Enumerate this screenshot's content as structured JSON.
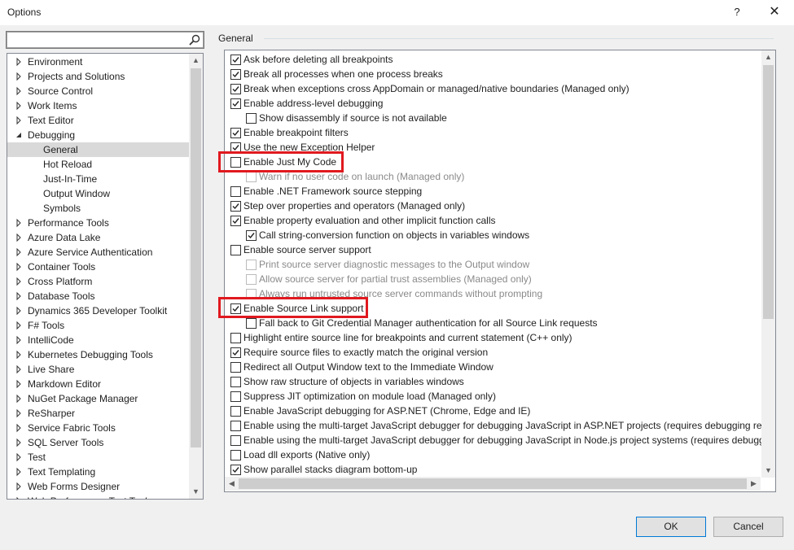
{
  "window": {
    "title": "Options",
    "help_glyph": "?",
    "close_glyph": "✕"
  },
  "search": {
    "value": "",
    "placeholder": ""
  },
  "tree": {
    "items": [
      {
        "label": "Environment",
        "expander": "collapsed",
        "level": 0
      },
      {
        "label": "Projects and Solutions",
        "expander": "collapsed",
        "level": 0
      },
      {
        "label": "Source Control",
        "expander": "collapsed",
        "level": 0
      },
      {
        "label": "Work Items",
        "expander": "collapsed",
        "level": 0
      },
      {
        "label": "Text Editor",
        "expander": "collapsed",
        "level": 0
      },
      {
        "label": "Debugging",
        "expander": "expanded",
        "level": 0
      },
      {
        "label": "General",
        "expander": "none",
        "level": 1,
        "selected": true
      },
      {
        "label": "Hot Reload",
        "expander": "none",
        "level": 1
      },
      {
        "label": "Just-In-Time",
        "expander": "none",
        "level": 1
      },
      {
        "label": "Output Window",
        "expander": "none",
        "level": 1
      },
      {
        "label": "Symbols",
        "expander": "none",
        "level": 1
      },
      {
        "label": "Performance Tools",
        "expander": "collapsed",
        "level": 0
      },
      {
        "label": "Azure Data Lake",
        "expander": "collapsed",
        "level": 0
      },
      {
        "label": "Azure Service Authentication",
        "expander": "collapsed",
        "level": 0
      },
      {
        "label": "Container Tools",
        "expander": "collapsed",
        "level": 0
      },
      {
        "label": "Cross Platform",
        "expander": "collapsed",
        "level": 0
      },
      {
        "label": "Database Tools",
        "expander": "collapsed",
        "level": 0
      },
      {
        "label": "Dynamics 365 Developer Toolkit",
        "expander": "collapsed",
        "level": 0
      },
      {
        "label": "F# Tools",
        "expander": "collapsed",
        "level": 0
      },
      {
        "label": "IntelliCode",
        "expander": "collapsed",
        "level": 0
      },
      {
        "label": "Kubernetes Debugging Tools",
        "expander": "collapsed",
        "level": 0
      },
      {
        "label": "Live Share",
        "expander": "collapsed",
        "level": 0
      },
      {
        "label": "Markdown Editor",
        "expander": "collapsed",
        "level": 0
      },
      {
        "label": "NuGet Package Manager",
        "expander": "collapsed",
        "level": 0
      },
      {
        "label": "ReSharper",
        "expander": "collapsed",
        "level": 0
      },
      {
        "label": "Service Fabric Tools",
        "expander": "collapsed",
        "level": 0
      },
      {
        "label": "SQL Server Tools",
        "expander": "collapsed",
        "level": 0
      },
      {
        "label": "Test",
        "expander": "collapsed",
        "level": 0
      },
      {
        "label": "Text Templating",
        "expander": "collapsed",
        "level": 0
      },
      {
        "label": "Web Forms Designer",
        "expander": "collapsed",
        "level": 0
      },
      {
        "label": "Web Performance Test Tools",
        "expander": "collapsed",
        "level": 0
      }
    ]
  },
  "page": {
    "group_label": "General"
  },
  "options": [
    {
      "label": "Ask before deleting all breakpoints",
      "checked": true,
      "indent": 0,
      "enabled": true
    },
    {
      "label": "Break all processes when one process breaks",
      "checked": true,
      "indent": 0,
      "enabled": true
    },
    {
      "label": "Break when exceptions cross AppDomain or managed/native boundaries (Managed only)",
      "checked": true,
      "indent": 0,
      "enabled": true
    },
    {
      "label": "Enable address-level debugging",
      "checked": true,
      "indent": 0,
      "enabled": true
    },
    {
      "label": "Show disassembly if source is not available",
      "checked": false,
      "indent": 1,
      "enabled": true
    },
    {
      "label": "Enable breakpoint filters",
      "checked": true,
      "indent": 0,
      "enabled": true
    },
    {
      "label": "Use the new Exception Helper",
      "checked": true,
      "indent": 0,
      "enabled": true
    },
    {
      "label": "Enable Just My Code",
      "checked": false,
      "indent": 0,
      "enabled": true,
      "highlighted": true
    },
    {
      "label": "Warn if no user code on launch (Managed only)",
      "checked": false,
      "indent": 1,
      "enabled": false
    },
    {
      "label": "Enable .NET Framework source stepping",
      "checked": false,
      "indent": 0,
      "enabled": true
    },
    {
      "label": "Step over properties and operators (Managed only)",
      "checked": true,
      "indent": 0,
      "enabled": true
    },
    {
      "label": "Enable property evaluation and other implicit function calls",
      "checked": true,
      "indent": 0,
      "enabled": true
    },
    {
      "label": "Call string-conversion function on objects in variables windows",
      "checked": true,
      "indent": 1,
      "enabled": true
    },
    {
      "label": "Enable source server support",
      "checked": false,
      "indent": 0,
      "enabled": true
    },
    {
      "label": "Print source server diagnostic messages to the Output window",
      "checked": false,
      "indent": 1,
      "enabled": false
    },
    {
      "label": "Allow source server for partial trust assemblies (Managed only)",
      "checked": false,
      "indent": 1,
      "enabled": false
    },
    {
      "label": "Always run untrusted source server commands without prompting",
      "checked": false,
      "indent": 1,
      "enabled": false
    },
    {
      "label": "Enable Source Link support",
      "checked": true,
      "indent": 0,
      "enabled": true,
      "highlighted": true
    },
    {
      "label": "Fall back to Git Credential Manager authentication for all Source Link requests",
      "checked": false,
      "indent": 1,
      "enabled": true
    },
    {
      "label": "Highlight entire source line for breakpoints and current statement (C++ only)",
      "checked": false,
      "indent": 0,
      "enabled": true
    },
    {
      "label": "Require source files to exactly match the original version",
      "checked": true,
      "indent": 0,
      "enabled": true
    },
    {
      "label": "Redirect all Output Window text to the Immediate Window",
      "checked": false,
      "indent": 0,
      "enabled": true
    },
    {
      "label": "Show raw structure of objects in variables windows",
      "checked": false,
      "indent": 0,
      "enabled": true
    },
    {
      "label": "Suppress JIT optimization on module load (Managed only)",
      "checked": false,
      "indent": 0,
      "enabled": true
    },
    {
      "label": "Enable JavaScript debugging for ASP.NET (Chrome, Edge and IE)",
      "checked": false,
      "indent": 0,
      "enabled": true
    },
    {
      "label": "Enable using the multi-target JavaScript debugger for debugging JavaScript in ASP.NET projects (requires debugging rest",
      "checked": false,
      "indent": 0,
      "enabled": true
    },
    {
      "label": "Enable using the multi-target JavaScript debugger for debugging JavaScript in Node.js project systems (requires debuggi",
      "checked": false,
      "indent": 0,
      "enabled": true
    },
    {
      "label": "Load dll exports (Native only)",
      "checked": false,
      "indent": 0,
      "enabled": true
    },
    {
      "label": "Show parallel stacks diagram bottom-up",
      "checked": true,
      "indent": 0,
      "enabled": true
    }
  ],
  "buttons": {
    "ok": "OK",
    "cancel": "Cancel"
  },
  "colors": {
    "highlight_box": "#e0191f",
    "tree_selection": "#d9d9d9",
    "ok_border": "#0078d7"
  },
  "icons": {
    "search": "search-icon",
    "expander_collapsed": "caret-right-icon",
    "expander_expanded": "caret-down-icon"
  }
}
